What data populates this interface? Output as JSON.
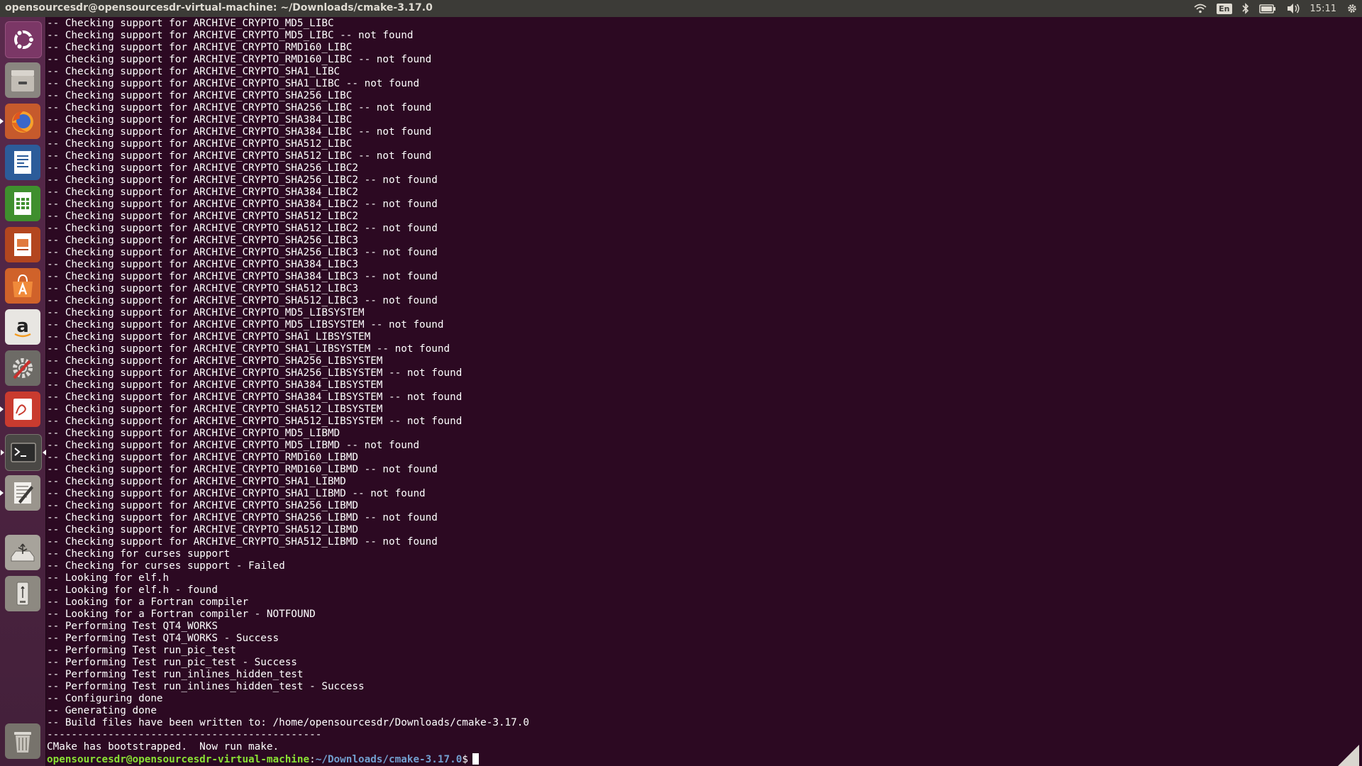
{
  "window": {
    "title": "opensourcesdr@opensourcesdr-virtual-machine: ~/Downloads/cmake-3.17.0"
  },
  "tray": {
    "keyboard_layout": "En",
    "clock": "15:11",
    "icons": [
      "wifi-icon",
      "keyboard-layout-indicator",
      "bluetooth-icon",
      "battery-icon",
      "volume-icon",
      "gear-icon"
    ]
  },
  "launcher": {
    "items": [
      "ubuntu-dash-icon",
      "files-icon",
      "firefox-icon",
      "libreoffice-writer-icon",
      "libreoffice-calc-icon",
      "libreoffice-impress-icon",
      "software-center-icon",
      "amazon-icon",
      "system-settings-icon",
      "document-viewer-icon",
      "terminal-icon",
      "text-editor-icon",
      "usb-drive-icon",
      "removable-drive-icon",
      "trash-icon"
    ]
  },
  "colors": {
    "terminal_bg": "#2c0922",
    "prompt_user": "#8ae234",
    "prompt_path": "#729fcf",
    "text": "#ffffff"
  },
  "terminal": {
    "lines": [
      "-- Checking support for ARCHIVE_CRYPTO_MD5_LIBC",
      "-- Checking support for ARCHIVE_CRYPTO_MD5_LIBC -- not found",
      "-- Checking support for ARCHIVE_CRYPTO_RMD160_LIBC",
      "-- Checking support for ARCHIVE_CRYPTO_RMD160_LIBC -- not found",
      "-- Checking support for ARCHIVE_CRYPTO_SHA1_LIBC",
      "-- Checking support for ARCHIVE_CRYPTO_SHA1_LIBC -- not found",
      "-- Checking support for ARCHIVE_CRYPTO_SHA256_LIBC",
      "-- Checking support for ARCHIVE_CRYPTO_SHA256_LIBC -- not found",
      "-- Checking support for ARCHIVE_CRYPTO_SHA384_LIBC",
      "-- Checking support for ARCHIVE_CRYPTO_SHA384_LIBC -- not found",
      "-- Checking support for ARCHIVE_CRYPTO_SHA512_LIBC",
      "-- Checking support for ARCHIVE_CRYPTO_SHA512_LIBC -- not found",
      "-- Checking support for ARCHIVE_CRYPTO_SHA256_LIBC2",
      "-- Checking support for ARCHIVE_CRYPTO_SHA256_LIBC2 -- not found",
      "-- Checking support for ARCHIVE_CRYPTO_SHA384_LIBC2",
      "-- Checking support for ARCHIVE_CRYPTO_SHA384_LIBC2 -- not found",
      "-- Checking support for ARCHIVE_CRYPTO_SHA512_LIBC2",
      "-- Checking support for ARCHIVE_CRYPTO_SHA512_LIBC2 -- not found",
      "-- Checking support for ARCHIVE_CRYPTO_SHA256_LIBC3",
      "-- Checking support for ARCHIVE_CRYPTO_SHA256_LIBC3 -- not found",
      "-- Checking support for ARCHIVE_CRYPTO_SHA384_LIBC3",
      "-- Checking support for ARCHIVE_CRYPTO_SHA384_LIBC3 -- not found",
      "-- Checking support for ARCHIVE_CRYPTO_SHA512_LIBC3",
      "-- Checking support for ARCHIVE_CRYPTO_SHA512_LIBC3 -- not found",
      "-- Checking support for ARCHIVE_CRYPTO_MD5_LIBSYSTEM",
      "-- Checking support for ARCHIVE_CRYPTO_MD5_LIBSYSTEM -- not found",
      "-- Checking support for ARCHIVE_CRYPTO_SHA1_LIBSYSTEM",
      "-- Checking support for ARCHIVE_CRYPTO_SHA1_LIBSYSTEM -- not found",
      "-- Checking support for ARCHIVE_CRYPTO_SHA256_LIBSYSTEM",
      "-- Checking support for ARCHIVE_CRYPTO_SHA256_LIBSYSTEM -- not found",
      "-- Checking support for ARCHIVE_CRYPTO_SHA384_LIBSYSTEM",
      "-- Checking support for ARCHIVE_CRYPTO_SHA384_LIBSYSTEM -- not found",
      "-- Checking support for ARCHIVE_CRYPTO_SHA512_LIBSYSTEM",
      "-- Checking support for ARCHIVE_CRYPTO_SHA512_LIBSYSTEM -- not found",
      "-- Checking support for ARCHIVE_CRYPTO_MD5_LIBMD",
      "-- Checking support for ARCHIVE_CRYPTO_MD5_LIBMD -- not found",
      "-- Checking support for ARCHIVE_CRYPTO_RMD160_LIBMD",
      "-- Checking support for ARCHIVE_CRYPTO_RMD160_LIBMD -- not found",
      "-- Checking support for ARCHIVE_CRYPTO_SHA1_LIBMD",
      "-- Checking support for ARCHIVE_CRYPTO_SHA1_LIBMD -- not found",
      "-- Checking support for ARCHIVE_CRYPTO_SHA256_LIBMD",
      "-- Checking support for ARCHIVE_CRYPTO_SHA256_LIBMD -- not found",
      "-- Checking support for ARCHIVE_CRYPTO_SHA512_LIBMD",
      "-- Checking support for ARCHIVE_CRYPTO_SHA512_LIBMD -- not found",
      "-- Checking for curses support",
      "-- Checking for curses support - Failed",
      "-- Looking for elf.h",
      "-- Looking for elf.h - found",
      "-- Looking for a Fortran compiler",
      "-- Looking for a Fortran compiler - NOTFOUND",
      "-- Performing Test QT4_WORKS",
      "-- Performing Test QT4_WORKS - Success",
      "-- Performing Test run_pic_test",
      "-- Performing Test run_pic_test - Success",
      "-- Performing Test run_inlines_hidden_test",
      "-- Performing Test run_inlines_hidden_test - Success",
      "-- Configuring done",
      "-- Generating done",
      "-- Build files have been written to: /home/opensourcesdr/Downloads/cmake-3.17.0",
      "---------------------------------------------",
      "CMake has bootstrapped.  Now run make."
    ],
    "prompt": {
      "user_host": "opensourcesdr@opensourcesdr-virtual-machine",
      "separator": ":",
      "path": "~/Downloads/cmake-3.17.0",
      "symbol": "$"
    }
  }
}
